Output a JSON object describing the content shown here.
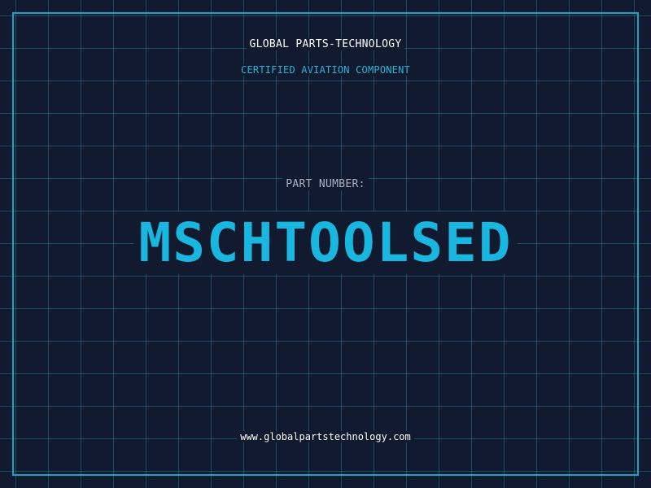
{
  "header": {
    "brand": "GLOBAL PARTS-TECHNOLOGY",
    "subtitle": "CERTIFIED AVIATION COMPONENT"
  },
  "main": {
    "label": "PART NUMBER:",
    "part_number": "MSCHTOOLSED"
  },
  "footer": {
    "website": "www.globalpartstechnology.com"
  },
  "colors": {
    "background": "#111a2e",
    "grid": "#24788c",
    "accent": "#19b6e0",
    "frame": "#1ea3c4",
    "text": "#ffffff",
    "muted": "#a9b2c2"
  }
}
